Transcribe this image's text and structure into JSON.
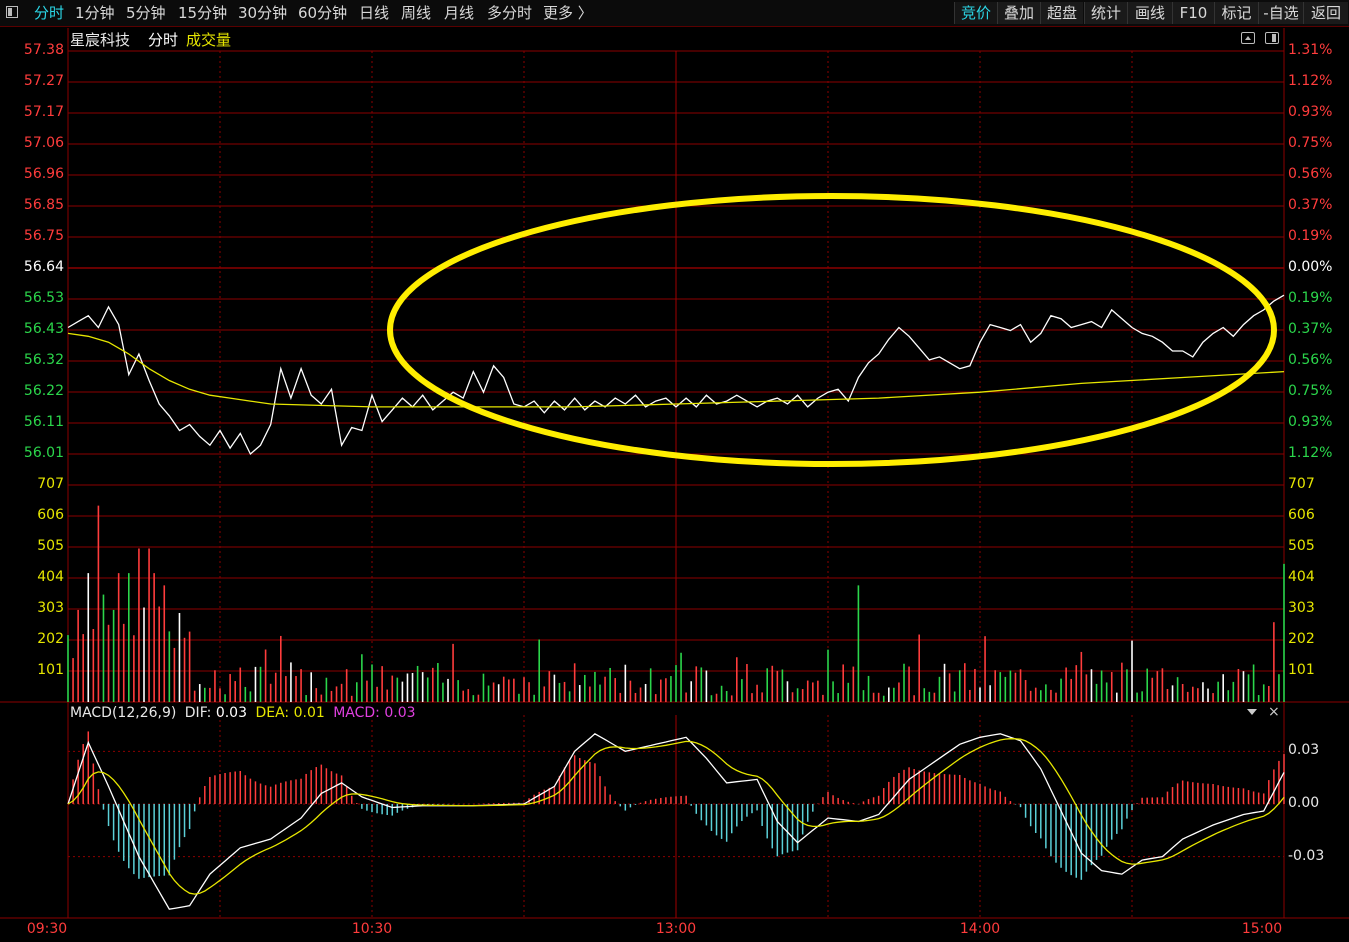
{
  "toolbar": {
    "left_items": [
      "分时",
      "1分钟",
      "5分钟",
      "15分钟",
      "30分钟",
      "60分钟",
      "日线",
      "周线",
      "月线",
      "多分时",
      "更多 〉"
    ],
    "active_left": 0,
    "right_buttons": [
      "竞价",
      "叠加",
      "超盘",
      "统计",
      "画线",
      "F10",
      "标记",
      "-自选",
      "返回"
    ],
    "active_right": 0
  },
  "header": {
    "stock_name": "星宸科技",
    "mode_label": "分时",
    "volume_label": "成交量"
  },
  "macd_header": {
    "name": "MACD(12,26,9)",
    "dif_label": "DIF:",
    "dif_value": "0.03",
    "dea_label": "DEA:",
    "dea_value": "0.01",
    "macd_label": "MACD:",
    "macd_value": "0.03"
  },
  "colors": {
    "up": "#ff3c3c",
    "down": "#2bd64b",
    "price_line": "#ffffff",
    "avg_line": "#e6e600",
    "macd_neg": "#5bd0d8",
    "highlight_ellipse": "#ffee00",
    "grid": "#8b0000"
  },
  "chart_data": [
    {
      "type": "line",
      "name": "intraday-price",
      "y_left_ticks": [
        "57.38",
        "57.27",
        "57.17",
        "57.06",
        "56.96",
        "56.85",
        "56.75",
        "56.64",
        "56.53",
        "56.43",
        "56.32",
        "56.22",
        "56.11",
        "56.01"
      ],
      "y_right_ticks": [
        "1.31%",
        "1.12%",
        "0.93%",
        "0.75%",
        "0.56%",
        "0.37%",
        "0.19%",
        "0.00%",
        "0.19%",
        "0.37%",
        "0.56%",
        "0.75%",
        "0.93%",
        "1.12%"
      ],
      "ylim": [
        56.01,
        57.38
      ],
      "prev_close": 56.64,
      "x_ticks": [
        "09:30",
        "10:30",
        "13:00",
        "14:00",
        "15:00"
      ],
      "x_range": [
        0,
        240
      ],
      "price": [
        [
          0,
          56.44
        ],
        [
          2,
          56.46
        ],
        [
          4,
          56.48
        ],
        [
          6,
          56.44
        ],
        [
          8,
          56.51
        ],
        [
          10,
          56.45
        ],
        [
          12,
          56.28
        ],
        [
          14,
          56.35
        ],
        [
          16,
          56.26
        ],
        [
          18,
          56.18
        ],
        [
          20,
          56.14
        ],
        [
          22,
          56.09
        ],
        [
          24,
          56.11
        ],
        [
          26,
          56.07
        ],
        [
          28,
          56.04
        ],
        [
          30,
          56.09
        ],
        [
          32,
          56.03
        ],
        [
          34,
          56.08
        ],
        [
          36,
          56.01
        ],
        [
          38,
          56.04
        ],
        [
          40,
          56.11
        ],
        [
          42,
          56.3
        ],
        [
          44,
          56.2
        ],
        [
          46,
          56.3
        ],
        [
          48,
          56.21
        ],
        [
          50,
          56.18
        ],
        [
          52,
          56.23
        ],
        [
          54,
          56.04
        ],
        [
          56,
          56.1
        ],
        [
          58,
          56.09
        ],
        [
          60,
          56.21
        ],
        [
          62,
          56.12
        ],
        [
          64,
          56.16
        ],
        [
          66,
          56.2
        ],
        [
          68,
          56.17
        ],
        [
          70,
          56.21
        ],
        [
          72,
          56.16
        ],
        [
          74,
          56.19
        ],
        [
          76,
          56.22
        ],
        [
          78,
          56.2
        ],
        [
          80,
          56.29
        ],
        [
          82,
          56.22
        ],
        [
          84,
          56.31
        ],
        [
          86,
          56.27
        ],
        [
          88,
          56.18
        ],
        [
          90,
          56.17
        ],
        [
          92,
          56.19
        ],
        [
          94,
          56.15
        ],
        [
          96,
          56.19
        ],
        [
          98,
          56.16
        ],
        [
          100,
          56.2
        ],
        [
          102,
          56.16
        ],
        [
          104,
          56.19
        ],
        [
          106,
          56.17
        ],
        [
          108,
          56.2
        ],
        [
          110,
          56.18
        ],
        [
          112,
          56.21
        ],
        [
          114,
          56.17
        ],
        [
          116,
          56.19
        ],
        [
          118,
          56.2
        ],
        [
          120,
          56.17
        ],
        [
          122,
          56.2
        ],
        [
          124,
          56.17
        ],
        [
          126,
          56.21
        ],
        [
          128,
          56.18
        ],
        [
          130,
          56.19
        ],
        [
          132,
          56.21
        ],
        [
          134,
          56.19
        ],
        [
          136,
          56.17
        ],
        [
          138,
          56.19
        ],
        [
          140,
          56.2
        ],
        [
          142,
          56.18
        ],
        [
          144,
          56.21
        ],
        [
          146,
          56.17
        ],
        [
          148,
          56.2
        ],
        [
          150,
          56.22
        ],
        [
          152,
          56.23
        ],
        [
          154,
          56.19
        ],
        [
          156,
          56.27
        ],
        [
          158,
          56.32
        ],
        [
          160,
          56.35
        ],
        [
          162,
          56.4
        ],
        [
          164,
          56.44
        ],
        [
          166,
          56.41
        ],
        [
          168,
          56.37
        ],
        [
          170,
          56.33
        ],
        [
          172,
          56.34
        ],
        [
          174,
          56.32
        ],
        [
          176,
          56.3
        ],
        [
          178,
          56.31
        ],
        [
          180,
          56.39
        ],
        [
          182,
          56.45
        ],
        [
          184,
          56.44
        ],
        [
          186,
          56.43
        ],
        [
          188,
          56.45
        ],
        [
          190,
          56.39
        ],
        [
          192,
          56.42
        ],
        [
          194,
          56.48
        ],
        [
          196,
          56.47
        ],
        [
          198,
          56.44
        ],
        [
          200,
          56.45
        ],
        [
          202,
          56.46
        ],
        [
          204,
          56.44
        ],
        [
          206,
          56.5
        ],
        [
          208,
          56.47
        ],
        [
          210,
          56.44
        ],
        [
          212,
          56.42
        ],
        [
          214,
          56.41
        ],
        [
          216,
          56.39
        ],
        [
          218,
          56.36
        ],
        [
          220,
          56.36
        ],
        [
          222,
          56.34
        ],
        [
          224,
          56.39
        ],
        [
          226,
          56.42
        ],
        [
          228,
          56.44
        ],
        [
          230,
          56.41
        ],
        [
          232,
          56.45
        ],
        [
          234,
          56.48
        ],
        [
          236,
          56.5
        ],
        [
          238,
          56.53
        ],
        [
          240,
          56.55
        ]
      ],
      "avg": [
        [
          0,
          56.42
        ],
        [
          4,
          56.41
        ],
        [
          8,
          56.39
        ],
        [
          12,
          56.35
        ],
        [
          16,
          56.3
        ],
        [
          20,
          56.26
        ],
        [
          24,
          56.23
        ],
        [
          28,
          56.21
        ],
        [
          32,
          56.2
        ],
        [
          36,
          56.19
        ],
        [
          40,
          56.18
        ],
        [
          60,
          56.17
        ],
        [
          80,
          56.17
        ],
        [
          100,
          56.17
        ],
        [
          120,
          56.18
        ],
        [
          140,
          56.19
        ],
        [
          160,
          56.2
        ],
        [
          180,
          56.22
        ],
        [
          200,
          56.25
        ],
        [
          220,
          56.27
        ],
        [
          240,
          56.29
        ]
      ]
    },
    {
      "type": "bar",
      "name": "volume",
      "y_ticks": [
        "707",
        "606",
        "505",
        "404",
        "303",
        "202",
        "101"
      ],
      "ylim": [
        0,
        707
      ],
      "x_range": [
        0,
        240
      ],
      "series": [
        {
          "values_up_down": "mixed"
        }
      ]
    },
    {
      "type": "line",
      "name": "macd",
      "y_ticks": [
        "0.03",
        "0.00",
        "-0.03"
      ],
      "ylim": [
        -0.065,
        0.045
      ],
      "x_range": [
        0,
        240
      ]
    }
  ]
}
